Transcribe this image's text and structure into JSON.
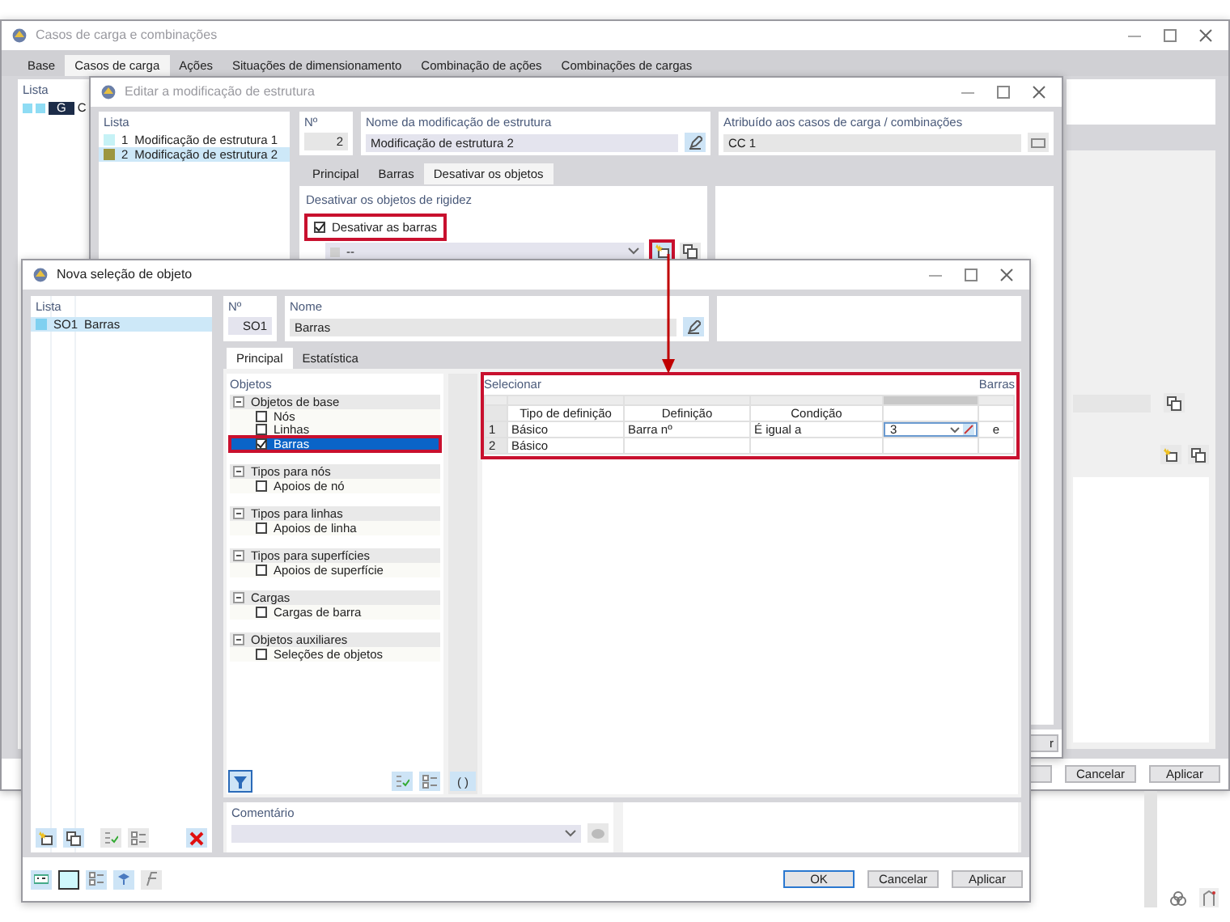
{
  "main_window": {
    "title": "Casos de carga e combinações",
    "tabs": [
      {
        "label": "Base",
        "selected": false
      },
      {
        "label": "Casos de carga",
        "selected": true
      },
      {
        "label": "Ações",
        "selected": false
      },
      {
        "label": "Situações de dimensionamento",
        "selected": false
      },
      {
        "label": "Combinação de ações",
        "selected": false
      },
      {
        "label": "Combinações de cargas",
        "selected": false
      }
    ],
    "list": {
      "title": "Lista",
      "items": [
        {
          "badge": "G",
          "label": "C"
        }
      ]
    },
    "buttons": [
      "Cancelar",
      "Aplicar"
    ]
  },
  "modification_dialog": {
    "title": "Editar a modificação de estrutura",
    "list": {
      "title": "Lista",
      "items": [
        {
          "number": "1",
          "name": "Modificação de estrutura 1",
          "color": "#c6f2f6",
          "selected": false
        },
        {
          "number": "2",
          "name": "Modificação de estrutura 2",
          "color": "#9c9640",
          "selected": true
        }
      ]
    },
    "number": {
      "label": "Nº",
      "value": "2"
    },
    "name": {
      "label": "Nome da modificação de estrutura",
      "value": "Modificação de estrutura 2"
    },
    "assigned": {
      "label": "Atribuído aos casos de carga / combinações",
      "value": "CC 1"
    },
    "tabs": [
      {
        "label": "Principal",
        "selected": false
      },
      {
        "label": "Barras",
        "selected": false
      },
      {
        "label": "Desativar os objetos",
        "selected": true
      }
    ],
    "section": {
      "title": "Desativar os objetos de rigidez",
      "checkbox": {
        "label": "Desativar as barras",
        "checked": true,
        "highlighted": true
      },
      "dropdown": {
        "value": "--"
      },
      "new_button": {
        "highlighted": true
      }
    },
    "buttons": [
      "r"
    ]
  },
  "selection_dialog": {
    "title": "Nova seleção de objeto",
    "list": {
      "title": "Lista",
      "items": [
        {
          "number": "SO1",
          "name": "Barras",
          "color": "#7fd0f0",
          "selected": true
        }
      ]
    },
    "number": {
      "label": "Nº",
      "value": "SO1"
    },
    "name": {
      "label": "Nome",
      "value": "Barras"
    },
    "tabs": [
      {
        "label": "Principal",
        "selected": true
      },
      {
        "label": "Estatística",
        "selected": false
      }
    ],
    "objects": {
      "title": "Objetos",
      "tree": [
        {
          "label": "Objetos de base",
          "expanded": true,
          "children": [
            {
              "label": "Nós",
              "checked": false,
              "selected": false,
              "highlighted": false
            },
            {
              "label": "Linhas",
              "checked": false,
              "selected": false,
              "highlighted": false
            },
            {
              "label": "Barras",
              "checked": true,
              "selected": true,
              "highlighted": true
            }
          ]
        },
        {
          "label": "Tipos para nós",
          "expanded": true,
          "children": [
            {
              "label": "Apoios de nó",
              "checked": false,
              "selected": false,
              "highlighted": false
            }
          ]
        },
        {
          "label": "Tipos para linhas",
          "expanded": true,
          "children": [
            {
              "label": "Apoios de linha",
              "checked": false,
              "selected": false,
              "highlighted": false
            }
          ]
        },
        {
          "label": "Tipos para superfícies",
          "expanded": true,
          "children": [
            {
              "label": "Apoios de superfície",
              "checked": false,
              "selected": false,
              "highlighted": false
            }
          ]
        },
        {
          "label": "Cargas",
          "expanded": true,
          "children": [
            {
              "label": "Cargas de barra",
              "checked": false,
              "selected": false,
              "highlighted": false
            }
          ]
        },
        {
          "label": "Objetos auxiliares",
          "expanded": true,
          "children": [
            {
              "label": "Seleções de objetos",
              "checked": false,
              "selected": false,
              "highlighted": false
            }
          ]
        }
      ]
    },
    "bracket_button": "( )",
    "select": {
      "title": "Selecionar",
      "object_type": "Barras",
      "highlighted": true,
      "columns": [
        "Tipo de definição",
        "Definição",
        "Condição"
      ],
      "rows": [
        {
          "number": "1",
          "type": "Básico",
          "definition": "Barra nº",
          "condition": "É igual a",
          "value": "3",
          "operator": "e"
        },
        {
          "number": "2",
          "type": "Básico"
        }
      ]
    },
    "comment": {
      "label": "Comentário"
    },
    "buttons": [
      {
        "label": "OK",
        "default": true
      },
      {
        "label": "Cancelar",
        "default": false
      },
      {
        "label": "Aplicar",
        "default": false
      }
    ]
  }
}
